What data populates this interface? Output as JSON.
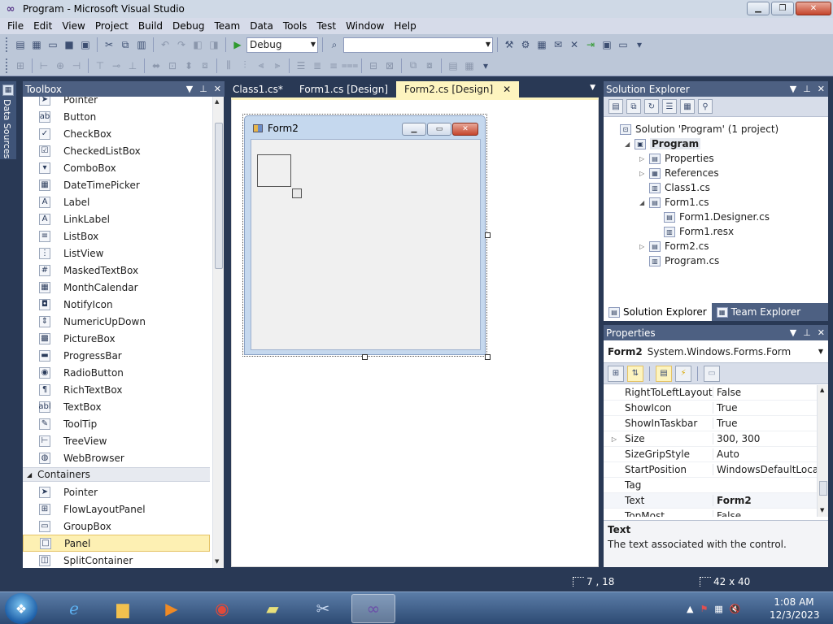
{
  "window": {
    "title": "Program - Microsoft Visual Studio"
  },
  "menu": [
    "File",
    "Edit",
    "View",
    "Project",
    "Build",
    "Debug",
    "Team",
    "Data",
    "Tools",
    "Test",
    "Window",
    "Help"
  ],
  "toolbar": {
    "config": "Debug",
    "platform": ""
  },
  "side": {
    "data_sources": "Data Sources"
  },
  "toolbox": {
    "title": "Toolbox",
    "items_top": [
      "Pointer",
      "Button",
      "CheckBox",
      "CheckedListBox",
      "ComboBox",
      "DateTimePicker",
      "Label",
      "LinkLabel",
      "ListBox",
      "ListView",
      "MaskedTextBox",
      "MonthCalendar",
      "NotifyIcon",
      "NumericUpDown",
      "PictureBox",
      "ProgressBar",
      "RadioButton",
      "RichTextBox",
      "TextBox",
      "ToolTip",
      "TreeView",
      "WebBrowser"
    ],
    "category": "Containers",
    "items_containers": [
      "Pointer",
      "FlowLayoutPanel",
      "GroupBox",
      "Panel",
      "SplitContainer"
    ],
    "selected": "Panel"
  },
  "tabs": [
    {
      "label": "Class1.cs*",
      "active": false
    },
    {
      "label": "Form1.cs [Design]",
      "active": false
    },
    {
      "label": "Form2.cs [Design]",
      "active": true
    }
  ],
  "designer": {
    "form_title": "Form2"
  },
  "solution_explorer": {
    "title": "Solution Explorer",
    "nodes": [
      {
        "label": "Solution 'Program' (1 project)",
        "level": 0,
        "exp": ""
      },
      {
        "label": "Program",
        "level": 1,
        "exp": "◢",
        "bold": true
      },
      {
        "label": "Properties",
        "level": 2,
        "exp": "▷"
      },
      {
        "label": "References",
        "level": 2,
        "exp": "▷"
      },
      {
        "label": "Class1.cs",
        "level": 2,
        "exp": ""
      },
      {
        "label": "Form1.cs",
        "level": 2,
        "exp": "◢"
      },
      {
        "label": "Form1.Designer.cs",
        "level": 3,
        "exp": ""
      },
      {
        "label": "Form1.resx",
        "level": 3,
        "exp": ""
      },
      {
        "label": "Form2.cs",
        "level": 2,
        "exp": "▷"
      },
      {
        "label": "Program.cs",
        "level": 2,
        "exp": ""
      }
    ],
    "tab_solution": "Solution Explorer",
    "tab_team": "Team Explorer"
  },
  "properties": {
    "title": "Properties",
    "object_name": "Form2",
    "object_type": "System.Windows.Forms.Form",
    "rows": [
      {
        "name": "RightToLeftLayout",
        "value": "False",
        "exp": ""
      },
      {
        "name": "ShowIcon",
        "value": "True",
        "exp": ""
      },
      {
        "name": "ShowInTaskbar",
        "value": "True",
        "exp": ""
      },
      {
        "name": "Size",
        "value": "300, 300",
        "exp": "▷"
      },
      {
        "name": "SizeGripStyle",
        "value": "Auto",
        "exp": ""
      },
      {
        "name": "StartPosition",
        "value": "WindowsDefaultLocati",
        "exp": ""
      },
      {
        "name": "Tag",
        "value": "",
        "exp": ""
      },
      {
        "name": "Text",
        "value": "Form2",
        "exp": "",
        "bold": true
      },
      {
        "name": "TopMost",
        "value": "False",
        "exp": ""
      }
    ],
    "desc_title": "Text",
    "desc_text": "The text associated with the control."
  },
  "status": {
    "position": "7 , 18",
    "size": "42 x 40"
  },
  "clock": {
    "time": "1:08 AM",
    "date": "12/3/2023"
  }
}
